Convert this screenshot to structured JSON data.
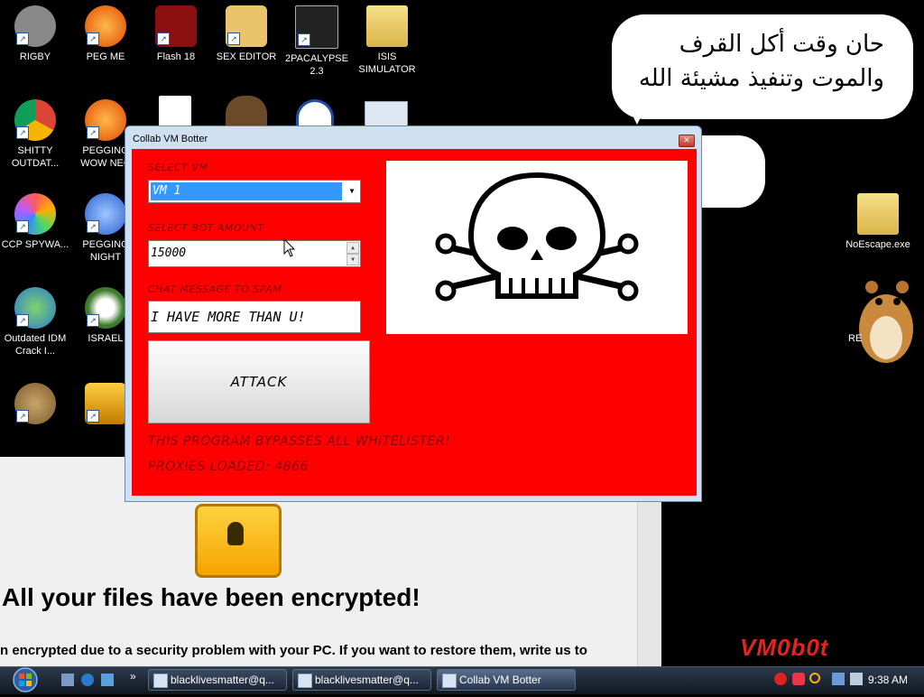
{
  "desktop": {
    "icons": [
      {
        "label": "RIGBY"
      },
      {
        "label": "PEG ME"
      },
      {
        "label": "Flash 18"
      },
      {
        "label": "SEX EDITOR"
      },
      {
        "label": "2PACALYPSE 2.3"
      },
      {
        "label": "ISIS SIMULATOR"
      },
      {
        "label": "SHITTY OUTDAT..."
      },
      {
        "label": "PEGGING WOW NEC"
      },
      {
        "label": "CCP SPYWA..."
      },
      {
        "label": "PEGGING NIGHT"
      },
      {
        "label": "Outdated IDM Crack I..."
      },
      {
        "label": "ISRAEL"
      },
      {
        "label": "NoEscape.exe"
      },
      {
        "label": "RE"
      }
    ],
    "speech_bubble": [
      "حان وقت أكل القرف",
      "والموت وتنفيذ مشيئة الله"
    ],
    "watermark": "VM0b0t"
  },
  "ransom_window": {
    "title": "All your files have been encrypted!",
    "body": "n encrypted due to a security problem with your PC. If you want to restore them, write us to"
  },
  "app_window": {
    "title": "Collab VM Botter",
    "close_glyph": "✕",
    "select_vm_label": "SELECT VM",
    "select_vm_value": "VM 1",
    "dropdown_glyph": "▼",
    "bot_amount_label": "SELECT BOT AMOUNT",
    "bot_amount_value": "15000",
    "spin_up_glyph": "▲",
    "spin_down_glyph": "▼",
    "chat_label": "CHAT MESSAGE TO SPAM",
    "chat_value": "I HAVE MORE THAN U!",
    "attack_label": "ATTACK",
    "note_bypass": "THIS PROGRAM BYPASSES ALL WHITELISTER!",
    "note_proxies": "PROXIES LOADED: 4866",
    "accent_color": "#ff0000"
  },
  "taskbar": {
    "buttons": [
      {
        "label": "blacklivesmatter@q..."
      },
      {
        "label": "blacklivesmatter@q..."
      },
      {
        "label": "Collab VM Botter"
      }
    ],
    "show_more_glyph": "»",
    "clock": "9:38 AM"
  }
}
